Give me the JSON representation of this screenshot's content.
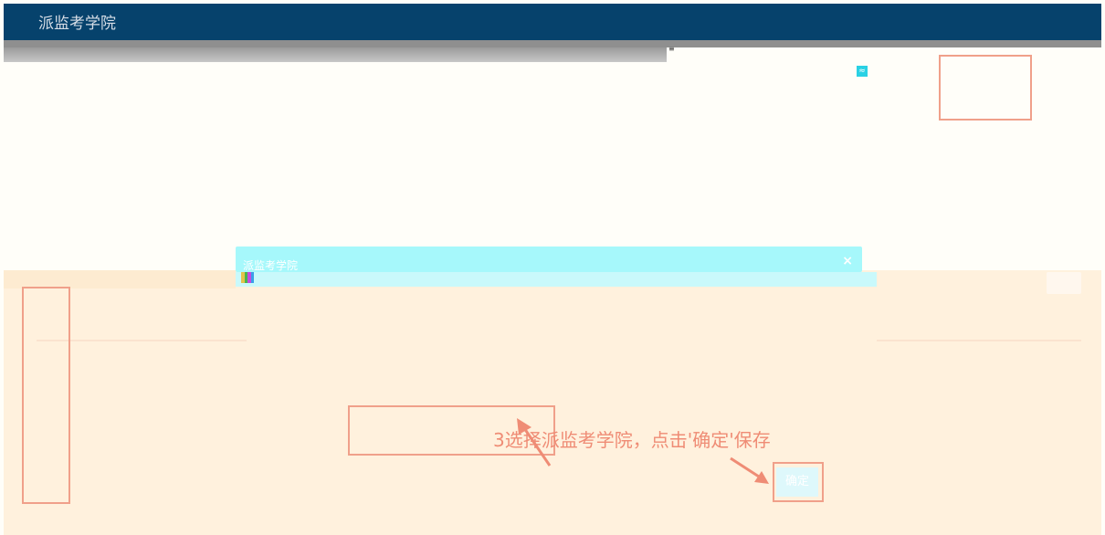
{
  "window": {
    "title": "派监考学院"
  },
  "modal": {
    "title": "派监考学院",
    "close_label": "×"
  },
  "annotation": {
    "text": "3选择派监考学院，点击'确定'保存"
  },
  "buttons": {
    "ok_label": "确定"
  },
  "colors": {
    "titlebar": "#06426c",
    "modal_header": "#a6f8fb",
    "annotation": "#ef8c75",
    "overlay": "#fff1dd"
  },
  "icons": {
    "modal_close": "close-icon",
    "toolbar": "toolbar-icon"
  }
}
